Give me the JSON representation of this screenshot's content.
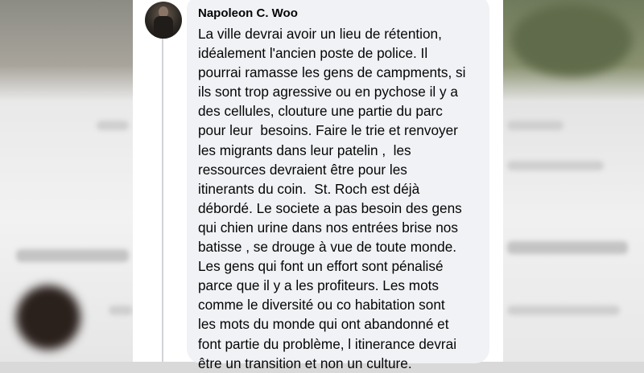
{
  "comment": {
    "author": "Napoleon C. Woo",
    "avatar_icon": "profile-photo",
    "lines": [
      "La ville devrai avoir un lieu de rétention,",
      "idéalement l'ancien poste de police. Il",
      "pourrai ramasse les gens de campments, si",
      "ils sont trop agressive ou en pychose il y a",
      "des cellules, clouture une partie du parc",
      "pour leur  besoins. Faire le trie et renvoyer",
      "les migrants dans leur patelin ,  les",
      "ressources devraient être pour les",
      "itinerants du coin.  St. Roch est déjà",
      "débordé. Le societe a pas besoin des gens",
      "qui chien urine dans nos entrées brise nos",
      "batisse , se drouge à vue de toute monde.",
      "Les gens qui font un effort sont pénalisé",
      "parce que il y a les profiteurs. Les mots",
      "comme le diversité ou co habitation sont",
      "les mots du monde qui ont abandonné et",
      "font partie du problème, l itinerance devrai",
      "être un transition et non un culture."
    ]
  },
  "colors": {
    "bubble": "#f0f2f5",
    "text": "#050505",
    "card": "#ffffff"
  }
}
